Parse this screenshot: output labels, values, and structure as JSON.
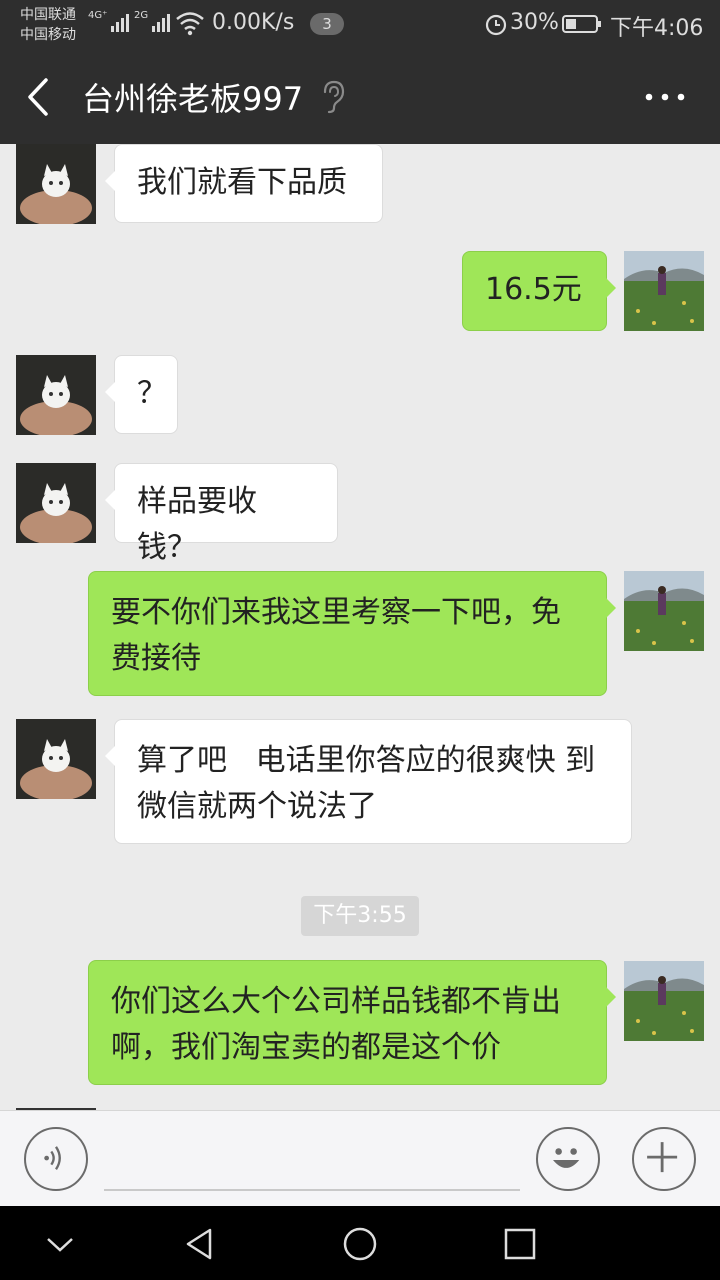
{
  "status_bar": {
    "carrier_1": "中国联通",
    "carrier_2": "中国移动",
    "network_1": "4G⁺",
    "network_2": "2G",
    "speed": "0.00K/s",
    "notification_count": "3",
    "battery": "30%",
    "time": "下午4:06"
  },
  "header": {
    "title": "台州徐老板997",
    "back_icon": "chevron-left-icon",
    "mode_icon": "ear-icon",
    "more_icon": "more-dots-icon"
  },
  "chat": {
    "messages": [
      {
        "side": "in",
        "text": "我们就看下品质"
      },
      {
        "side": "out",
        "text": "16.5元"
      },
      {
        "side": "in",
        "text": "？"
      },
      {
        "side": "in",
        "text": "样品要收钱？"
      },
      {
        "side": "out",
        "line1": "要不你们来我这里考察一下吧，免",
        "line2": "费接待"
      },
      {
        "side": "in",
        "line1": "算了吧   电话里你答应的很爽快 到",
        "line2": "微信就两个说法了"
      },
      {
        "side": "out",
        "line1": "你们这么大个公司样品钱都不肯出",
        "line2": "啊，我们淘宝卖的都是这个价"
      }
    ],
    "timestamp": "下午3:55"
  },
  "input_bar": {
    "voice_icon": "voice-icon",
    "emoji_icon": "emoji-icon",
    "plus_icon": "plus-icon",
    "placeholder": ""
  },
  "nav_bar": {
    "icons": [
      "chevron-down-icon",
      "back-triangle-icon",
      "home-circle-icon",
      "recents-square-icon"
    ]
  },
  "colors": {
    "header_bg": "#2e2e2e",
    "chat_bg": "#ebebeb",
    "outgoing_bubble": "#9fe658",
    "incoming_bubble": "#ffffff",
    "timestamp_bg": "#d6d6d6"
  }
}
